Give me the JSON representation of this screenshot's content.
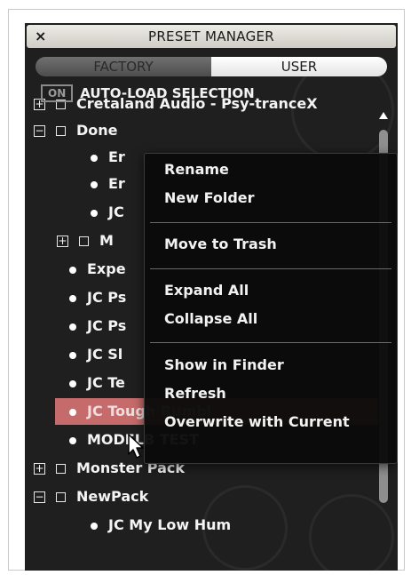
{
  "window": {
    "title": "PRESET MANAGER",
    "close_icon": "×"
  },
  "tabs": [
    {
      "label": "FACTORY",
      "active": false
    },
    {
      "label": "USER",
      "active": true
    }
  ],
  "autoload": {
    "toggle_label": "ON",
    "label": "AUTO-LOAD SELECTION"
  },
  "tree": {
    "items": [
      {
        "kind": "folder",
        "expanded": false,
        "label": "Cretaland Audio - Psy-tranceX"
      },
      {
        "kind": "folder",
        "expanded": true,
        "label": "Done"
      },
      {
        "kind": "preset",
        "label": "Er"
      },
      {
        "kind": "preset",
        "label": "Er"
      },
      {
        "kind": "preset",
        "label": "JC"
      },
      {
        "kind": "folder",
        "expanded": false,
        "label": "M"
      },
      {
        "kind": "preset",
        "label": "Expe"
      },
      {
        "kind": "preset",
        "label": "JC Ps"
      },
      {
        "kind": "preset",
        "label": "JC Ps"
      },
      {
        "kind": "preset",
        "label": "JC Sl"
      },
      {
        "kind": "preset",
        "label": "JC Te"
      },
      {
        "kind": "preset",
        "label": "JC Tough Rumbl",
        "selected": true
      },
      {
        "kind": "preset",
        "label": "MODELB TEST"
      },
      {
        "kind": "folder",
        "expanded": false,
        "label": "Monster Pack"
      },
      {
        "kind": "folder",
        "expanded": true,
        "label": "NewPack"
      },
      {
        "kind": "preset",
        "label": "JC My Low Hum"
      }
    ]
  },
  "context_menu": {
    "items": [
      {
        "label": "Rename"
      },
      {
        "label": "New Folder"
      },
      {
        "label": "Move to Trash"
      },
      {
        "label": "Expand All"
      },
      {
        "label": "Collapse All"
      },
      {
        "label": "Show in Finder"
      },
      {
        "label": "Refresh"
      },
      {
        "label": "Overwrite with Current"
      }
    ]
  },
  "colors": {
    "selected_row": "#c66b6b",
    "panel_bg": "#1f1f1f",
    "menu_bg": "#0a0a0a"
  }
}
